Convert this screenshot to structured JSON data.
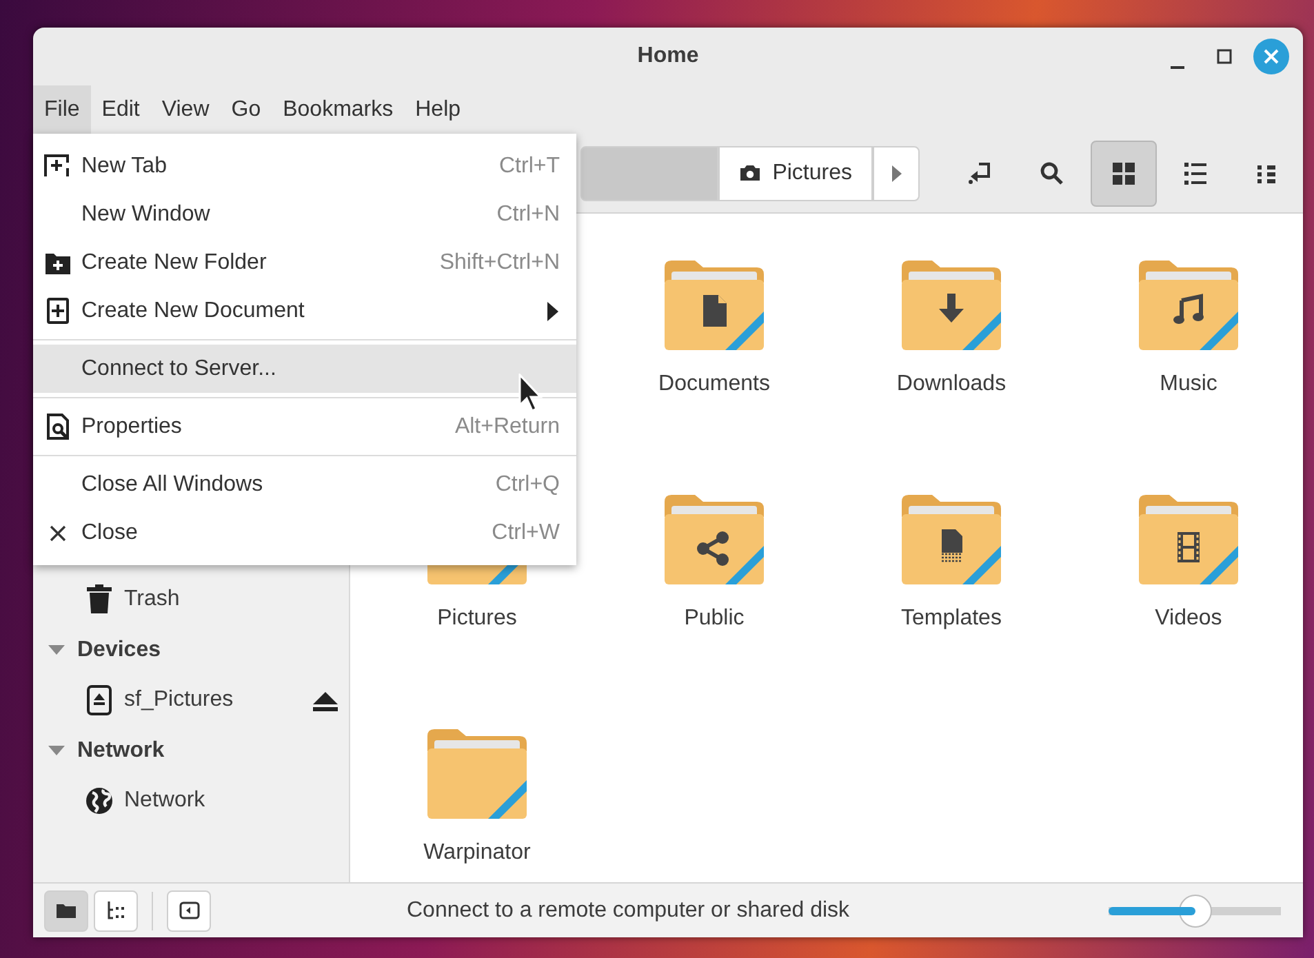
{
  "window": {
    "title": "Home"
  },
  "menubar": [
    {
      "label": "File",
      "selected": true
    },
    {
      "label": "Edit",
      "selected": false
    },
    {
      "label": "View",
      "selected": false
    },
    {
      "label": "Go",
      "selected": false
    },
    {
      "label": "Bookmarks",
      "selected": false
    },
    {
      "label": "Help",
      "selected": false
    }
  ],
  "pathbar": [
    {
      "kind": "blurred"
    },
    {
      "kind": "camera",
      "label": "Pictures"
    }
  ],
  "view_buttons": [
    {
      "kind": "grid",
      "selected": true
    },
    {
      "kind": "list",
      "selected": false
    },
    {
      "kind": "compact",
      "selected": false
    }
  ],
  "sidebar": [
    {
      "kind": "trash",
      "label": "Trash",
      "eject": false
    },
    {
      "kind": "header",
      "label": "Devices",
      "expanded": true
    },
    {
      "kind": "drive",
      "label": "sf_Pictures",
      "eject": true
    },
    {
      "kind": "header",
      "label": "Network",
      "expanded": true
    },
    {
      "kind": "globe",
      "label": "Network",
      "eject": false
    }
  ],
  "files": [
    {
      "name": "Documents",
      "kind": "documents"
    },
    {
      "name": "Downloads",
      "kind": "downloads"
    },
    {
      "name": "Music",
      "kind": "music"
    },
    {
      "name": "Pictures",
      "kind": "pictures"
    },
    {
      "name": "Public",
      "kind": "public"
    },
    {
      "name": "Templates",
      "kind": "templates"
    },
    {
      "name": "Videos",
      "kind": "videos"
    },
    {
      "name": "Warpinator",
      "kind": "plain"
    }
  ],
  "file_menu": [
    {
      "kind": "tab",
      "label": "New Tab",
      "shortcut": "Ctrl+T",
      "submenu": false,
      "highlighted": false
    },
    {
      "kind": "plain",
      "label": "New Window",
      "shortcut": "Ctrl+N",
      "submenu": false,
      "highlighted": false
    },
    {
      "kind": "folder",
      "label": "Create New Folder",
      "shortcut": "Shift+Ctrl+N",
      "submenu": false,
      "highlighted": false
    },
    {
      "kind": "document",
      "label": "Create New Document",
      "submenu": true,
      "highlighted": false
    },
    {
      "kind": "separator"
    },
    {
      "kind": "plain",
      "label": "Connect to Server...",
      "submenu": false,
      "highlighted": true
    },
    {
      "kind": "separator"
    },
    {
      "kind": "properties",
      "label": "Properties",
      "shortcut": "Alt+Return",
      "submenu": false,
      "highlighted": false
    },
    {
      "kind": "separator"
    },
    {
      "kind": "plain",
      "label": "Close All Windows",
      "shortcut": "Ctrl+Q",
      "submenu": false,
      "highlighted": false
    },
    {
      "kind": "close",
      "label": "Close",
      "shortcut": "Ctrl+W",
      "submenu": false,
      "highlighted": false
    }
  ],
  "status_bar": {
    "panes": [
      {
        "kind": "places",
        "selected": true
      },
      {
        "kind": "tree",
        "selected": false
      }
    ],
    "message": "Connect to a remote computer or shared disk",
    "zoom": {
      "level": 0.5
    }
  }
}
